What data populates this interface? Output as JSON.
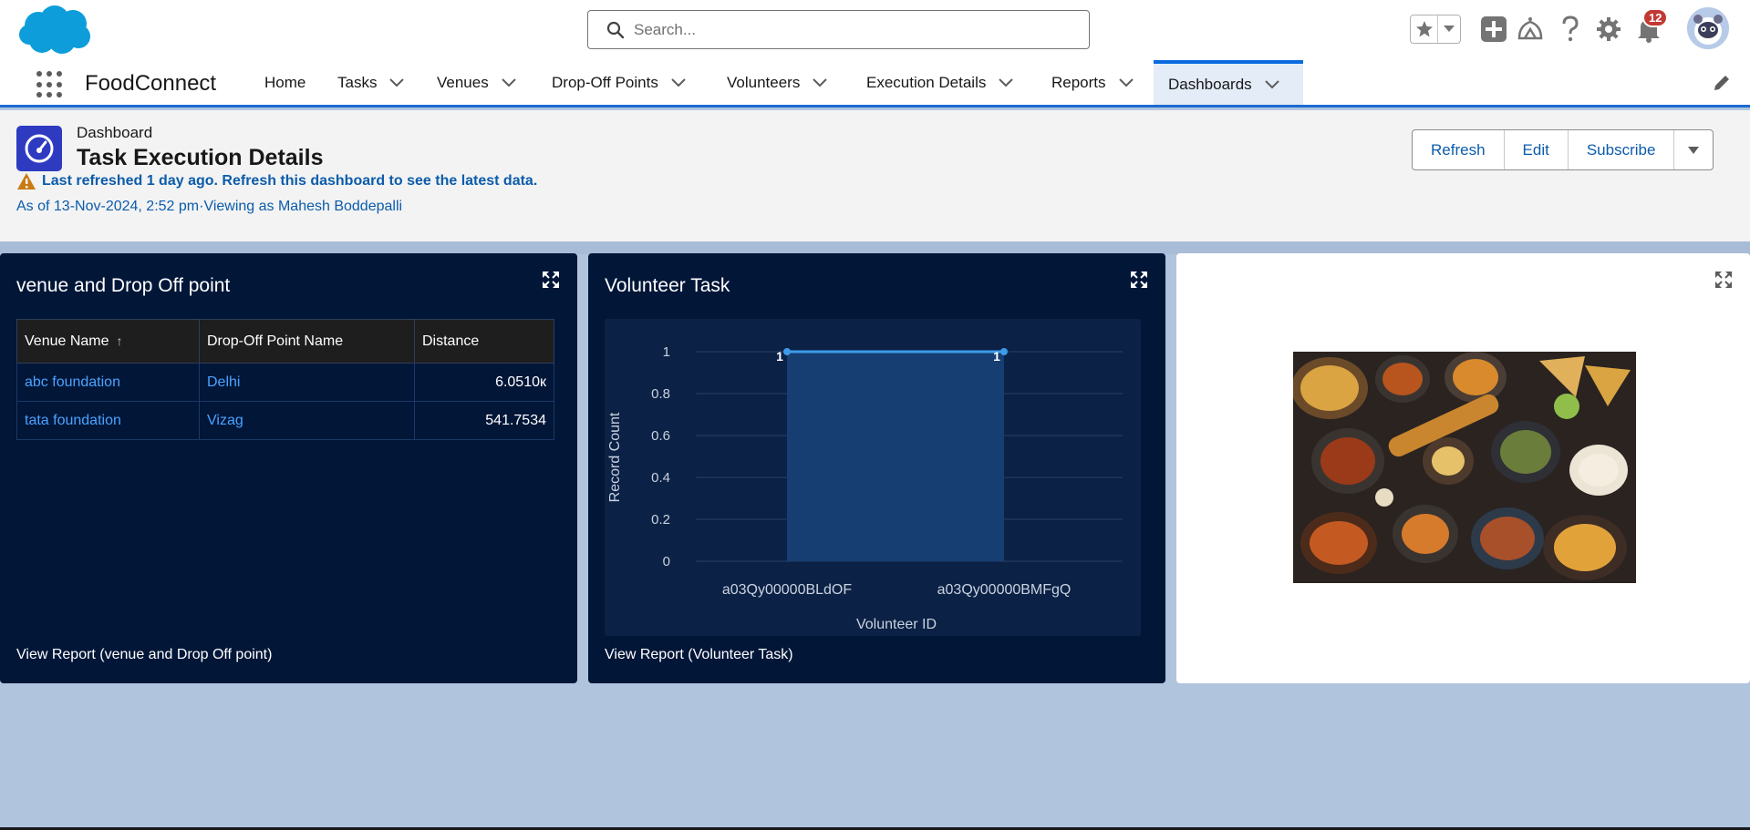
{
  "search": {
    "placeholder": "Search..."
  },
  "notifications": {
    "count": "12"
  },
  "app": {
    "name": "FoodConnect"
  },
  "nav": {
    "items": [
      {
        "label": "Home",
        "has_menu": false,
        "active": false
      },
      {
        "label": "Tasks",
        "has_menu": true,
        "active": false
      },
      {
        "label": "Venues",
        "has_menu": true,
        "active": false
      },
      {
        "label": "Drop-Off Points",
        "has_menu": true,
        "active": false
      },
      {
        "label": "Volunteers",
        "has_menu": true,
        "active": false
      },
      {
        "label": "Execution Details",
        "has_menu": true,
        "active": false
      },
      {
        "label": "Reports",
        "has_menu": true,
        "active": false
      },
      {
        "label": "Dashboards",
        "has_menu": true,
        "active": true
      }
    ]
  },
  "dashboard": {
    "type_label": "Dashboard",
    "title": "Task Execution Details",
    "warning": "Last refreshed 1 day ago. Refresh this dashboard to see the latest data.",
    "as_of": "As of 13-Nov-2024, 2:52 pm·Viewing as Mahesh Boddepalli",
    "buttons": {
      "refresh": "Refresh",
      "edit": "Edit",
      "subscribe": "Subscribe"
    }
  },
  "widget_table": {
    "title": "venue and Drop Off point",
    "columns": [
      "Venue Name",
      "Drop-Off Point Name",
      "Distance"
    ],
    "sort_indicator": "↑",
    "rows": [
      {
        "venue": "abc foundation",
        "dropoff": "Delhi",
        "distance": "6.0510к"
      },
      {
        "venue": "tata foundation",
        "dropoff": "Vizag",
        "distance": "541.7534"
      }
    ],
    "footer": "View Report (venue and Drop Off point)"
  },
  "widget_chart": {
    "title": "Volunteer Task",
    "footer": "View Report (Volunteer Task)"
  },
  "chart_data": {
    "type": "line",
    "title": "Volunteer Task",
    "xlabel": "Volunteer ID",
    "ylabel": "Record Count",
    "categories": [
      "a03Qy00000BLdOF",
      "a03Qy00000BMFgQ"
    ],
    "values": [
      1,
      1
    ],
    "data_labels": [
      "1",
      "1"
    ],
    "yticks": [
      "0",
      "0.2",
      "0.4",
      "0.6",
      "0.8",
      "1"
    ],
    "ylim": [
      0,
      1
    ],
    "grid": true,
    "colors": {
      "line": "#3d9be9",
      "area": "#163e73",
      "grid": "#2a3f62",
      "text": "#c9d2e0"
    }
  },
  "widget_image": {
    "alt": "Assorted food dishes"
  },
  "colors": {
    "brand": "#0b5cab",
    "nav_accent": "#1b6ad2",
    "widget_dark": "#021638",
    "page_bg": "#b0c4de"
  }
}
